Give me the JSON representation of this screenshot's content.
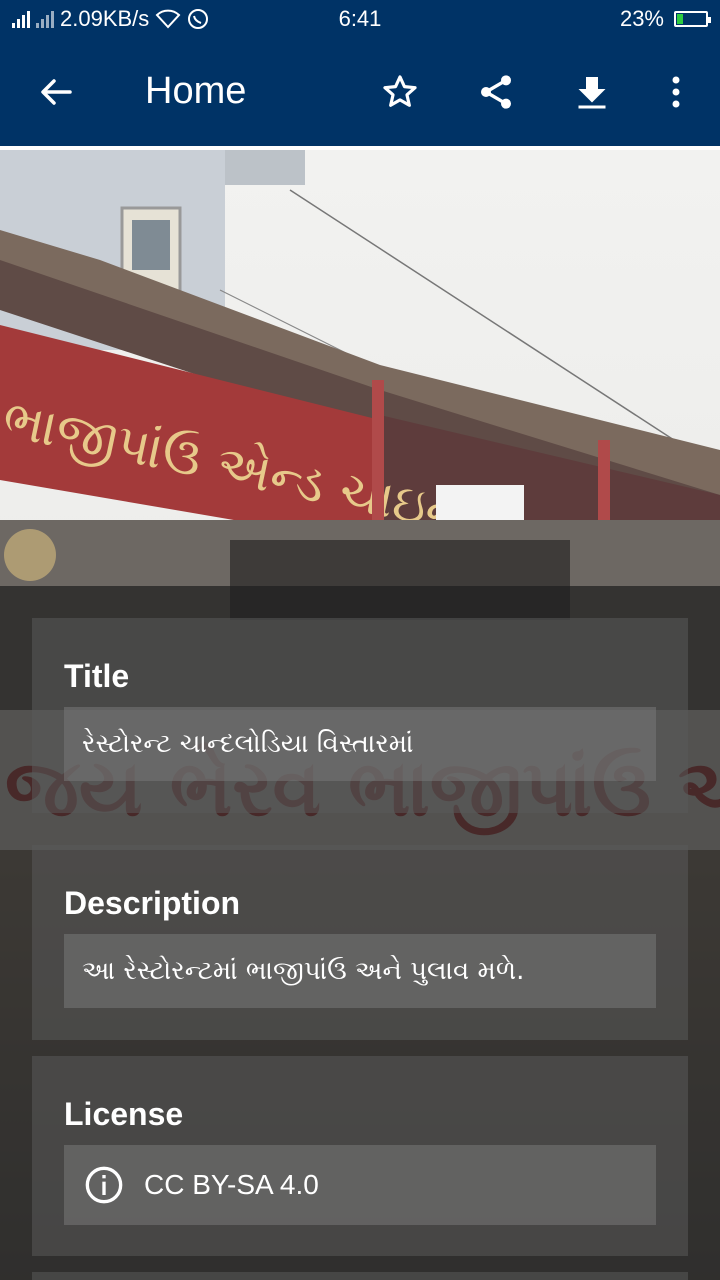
{
  "status_bar": {
    "network_speed": "2.09KB/s",
    "time": "6:41",
    "battery": "23%",
    "battery_level": 0.23
  },
  "app_bar": {
    "title": "Home",
    "back_icon": "arrow-back-icon",
    "star_icon": "star-outline-icon",
    "share_icon": "share-icon",
    "download_icon": "download-icon",
    "more_icon": "more-vert-icon"
  },
  "details": {
    "title_label": "Title",
    "title_value": "રેસ્ટોરન્ટ ચાન્દલોડિયા વિસ્તારમાં",
    "description_label": "Description",
    "description_value": "આ રેસ્ટોરન્ટમાં ભાજીપાંઉ અને પુલાવ મળે.",
    "license_label": "License",
    "license_value": "CC BY-SA 4.0",
    "license_icon": "info-icon"
  },
  "colors": {
    "app_bar": "#003366",
    "banner_red": "#a33a3a"
  }
}
